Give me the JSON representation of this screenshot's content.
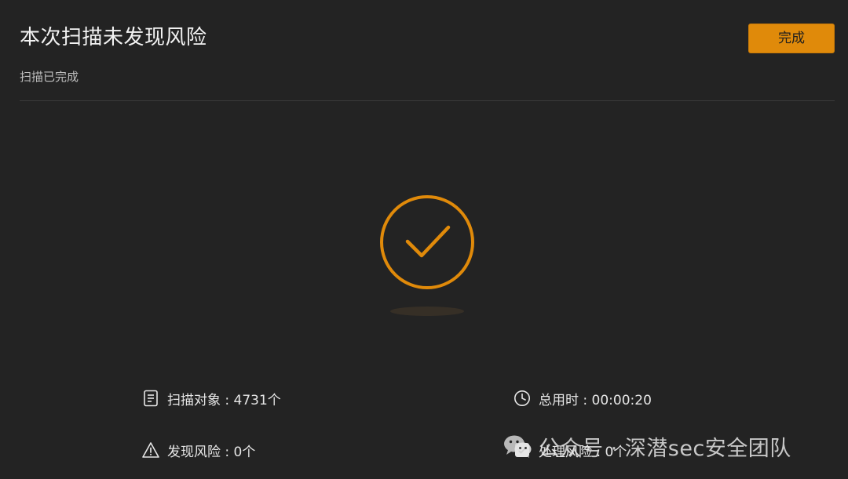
{
  "header": {
    "title": "本次扫描未发现风险",
    "subtitle": "扫描已完成",
    "done_label": "完成"
  },
  "status": {
    "icon": "checkmark-circle-icon",
    "accent_color": "#e08a0a"
  },
  "stats": {
    "objects": "扫描对象 : 4731个",
    "time": "总用时 : 00:00:20",
    "risks": "发现风险 : 0个",
    "handled": "处理风险 : 0个"
  },
  "watermark": {
    "text": "公众号 · 深潜sec安全团队"
  }
}
